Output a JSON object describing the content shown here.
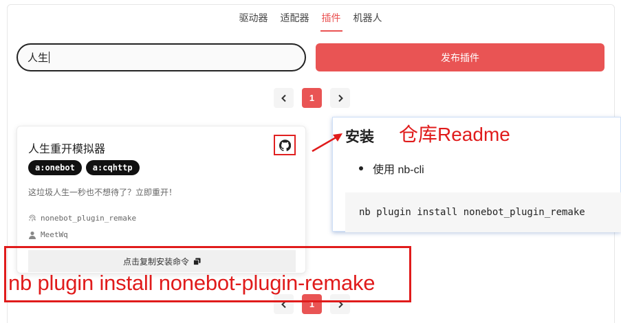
{
  "tabs": {
    "drivers": "驱动器",
    "adapters": "适配器",
    "plugins": "插件",
    "bots": "机器人",
    "active": "plugins"
  },
  "search": {
    "value": "人生"
  },
  "publish_label": "发布插件",
  "pagination": {
    "current_page": "1"
  },
  "plugin_card": {
    "title": "人生重开模拟器",
    "tags": [
      "a:onebot",
      "a:cqhttp"
    ],
    "description": "这垃圾人生一秒也不想待了？立即重开！",
    "module_name": "nonebot_plugin_remake",
    "author": "MeetWq",
    "copy_label": "点击复制安装命令",
    "icons": {
      "repo": "github-icon",
      "module": "fingerprint-icon",
      "author": "user-icon",
      "copy": "copy-icon"
    }
  },
  "readme_popup": {
    "heading": "安装",
    "bullet": "使用 nb-cli",
    "code": "nb plugin install nonebot_plugin_remake"
  },
  "annotations": {
    "readme_label": "仓库Readme",
    "install_command": "nb plugin install nonebot-plugin-remake",
    "color": "#e01b1b"
  },
  "colors": {
    "accent": "#e95454",
    "tag_bg": "#111111"
  }
}
